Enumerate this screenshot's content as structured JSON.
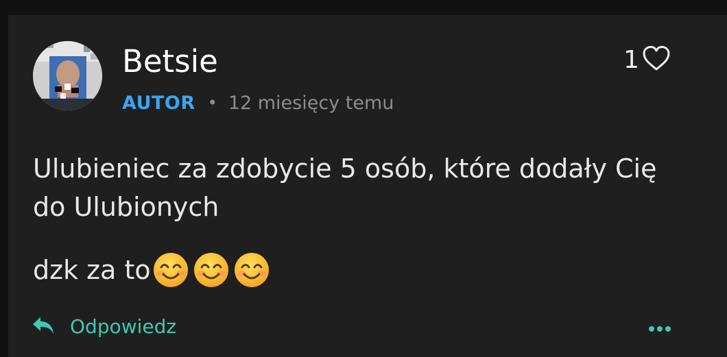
{
  "comment": {
    "author": "Betsie",
    "badge": "AUTOR",
    "separator": "•",
    "time_ago": "12 miesięcy temu",
    "like_count": "1",
    "body_paragraph_1": "Ulubieniec za zdobycie 5 osób, które dodały Cię do Ulubionych",
    "body_paragraph_2": "dzk za to",
    "emojis": [
      "smiling-face-icon",
      "smiling-face-icon",
      "smiling-face-icon"
    ]
  },
  "actions": {
    "reply_label": "Odpowiedz",
    "reply_icon": "reply-arrow-icon",
    "more_icon": "more-dots-icon"
  },
  "colors": {
    "accent_teal": "#3fc9b2",
    "author_badge_blue": "#3aa6f0",
    "card_background": "#1f1f1f",
    "muted_text": "#8d8d8d"
  }
}
